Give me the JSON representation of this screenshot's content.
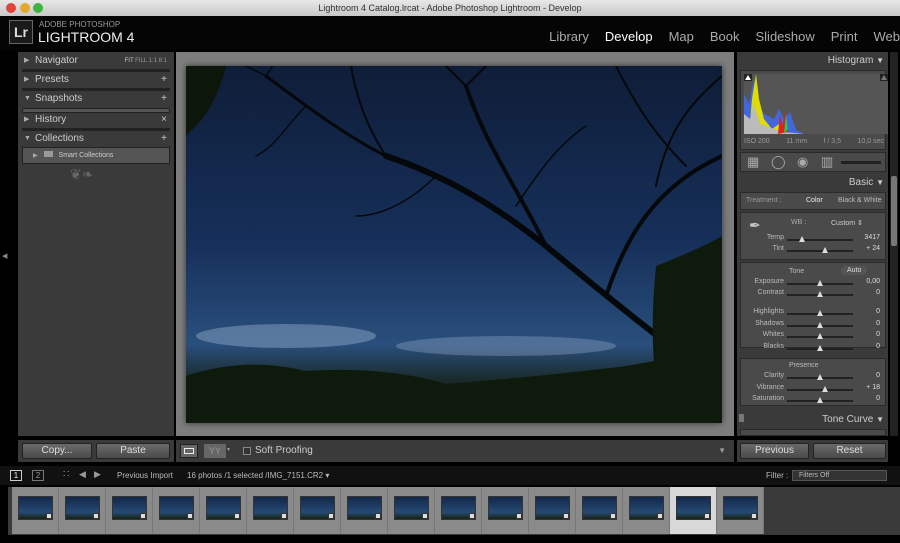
{
  "window": {
    "title": "Lightroom 4 Catalog.lrcat - Adobe Photoshop Lightroom - Develop"
  },
  "logo": {
    "mark": "Lr",
    "sub": "ADOBE PHOTOSHOP",
    "main": "LIGHTROOM 4"
  },
  "modules": [
    {
      "label": "Library"
    },
    {
      "label": "Develop",
      "active": true
    },
    {
      "label": "Map"
    },
    {
      "label": "Book"
    },
    {
      "label": "Slideshow"
    },
    {
      "label": "Print"
    },
    {
      "label": "Web"
    }
  ],
  "left": {
    "navigator": {
      "label": "Navigator",
      "zoom": [
        "FIT",
        "FILL",
        "1:1",
        "8:1"
      ]
    },
    "presets": {
      "label": "Presets",
      "action": "+"
    },
    "snapshots": {
      "label": "Snapshots",
      "action": "+"
    },
    "history": {
      "label": "History",
      "action": "×"
    },
    "collections": {
      "label": "Collections",
      "action": "+",
      "items": [
        {
          "label": "Smart Collections"
        }
      ]
    },
    "copy": "Copy...",
    "paste": "Paste"
  },
  "toolbar": {
    "soft_proofing": "Soft Proofing",
    "soft_proofing_checked": false
  },
  "right": {
    "histogram": {
      "label": "Histogram",
      "iso": "ISO 200",
      "focal": "11 mm",
      "aperture": "f / 3,5",
      "shutter": "10,0 sec"
    },
    "basic": {
      "label": "Basic",
      "treatment_label": "Treatment :",
      "treatment_color": "Color",
      "treatment_bw": "Black & White",
      "wb_label": "WB :",
      "wb_value": "Custom"
    },
    "wb_sliders": [
      {
        "label": "Temp",
        "value": "3417",
        "pos": 0.22
      },
      {
        "label": "Tint",
        "value": "+ 24",
        "pos": 0.58
      }
    ],
    "tone_label": "Tone",
    "auto": "Auto",
    "tone_sliders": [
      {
        "label": "Exposure",
        "value": "0,00",
        "pos": 0.5
      },
      {
        "label": "Contrast",
        "value": "0",
        "pos": 0.5
      }
    ],
    "tone2_sliders": [
      {
        "label": "Highlights",
        "value": "0",
        "pos": 0.5
      },
      {
        "label": "Shadows",
        "value": "0",
        "pos": 0.5
      },
      {
        "label": "Whites",
        "value": "0",
        "pos": 0.5
      },
      {
        "label": "Blacks",
        "value": "0",
        "pos": 0.5
      }
    ],
    "presence_label": "Presence",
    "presence_sliders": [
      {
        "label": "Clarity",
        "value": "0",
        "pos": 0.5
      },
      {
        "label": "Vibrance",
        "value": "+ 18",
        "pos": 0.58
      },
      {
        "label": "Saturation",
        "value": "0",
        "pos": 0.5
      }
    ],
    "tone_curve": "Tone Curve",
    "previous": "Previous",
    "reset": "Reset"
  },
  "filmbar": {
    "view1": "1",
    "view2": "2",
    "source": "Previous Import",
    "info": "16 photos /1 selected /IMG_7151.CR2",
    "filter_label": "Filter :",
    "filter_value": "Filters Off"
  },
  "filmstrip": {
    "count": 16,
    "selected_index": 14
  }
}
